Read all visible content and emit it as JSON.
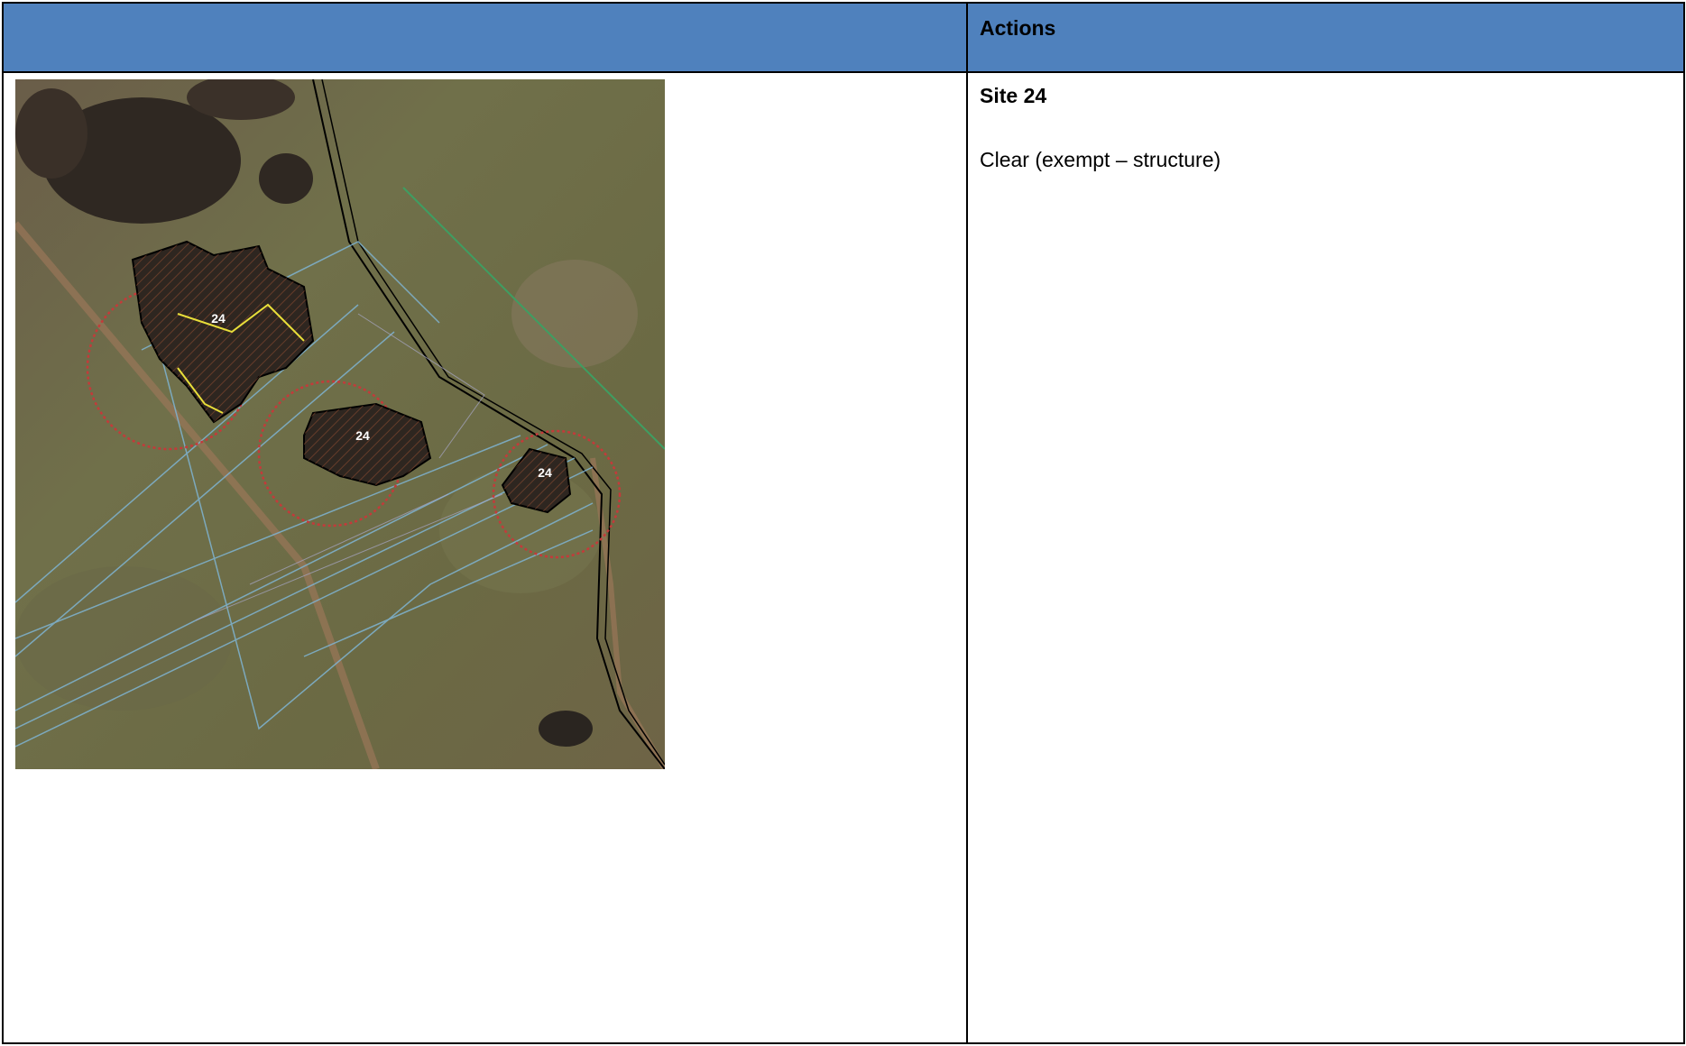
{
  "header": {
    "left_label": "",
    "actions_label": "Actions"
  },
  "site": {
    "title": "Site 24",
    "status": "Clear (exempt – structure)"
  },
  "map": {
    "labels": [
      "24",
      "24",
      "24"
    ],
    "colors": {
      "ground": "#6f6a45",
      "tree": "#2e2620",
      "boundary_black": "#000000",
      "buffer_red": "#c43a3a",
      "line_blue": "#7fb4d2",
      "line_green": "#3e9e62",
      "line_yellow": "#e8de3a",
      "track": "#9a7658"
    }
  }
}
